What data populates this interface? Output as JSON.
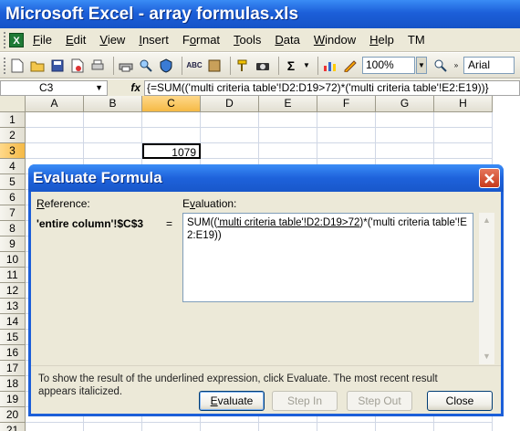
{
  "window": {
    "title": "Microsoft Excel - array formulas.xls"
  },
  "menu": {
    "items": [
      {
        "label": "File",
        "mnemonic": "F",
        "rest": "ile"
      },
      {
        "label": "Edit",
        "mnemonic": "E",
        "rest": "dit"
      },
      {
        "label": "View",
        "mnemonic": "V",
        "rest": "iew"
      },
      {
        "label": "Insert",
        "mnemonic": "I",
        "rest": "nsert"
      },
      {
        "label": "Format",
        "mnemonic": "o",
        "rest": ""
      },
      {
        "label": "Tools",
        "mnemonic": "T",
        "rest": "ools"
      },
      {
        "label": "Data",
        "mnemonic": "D",
        "rest": "ata"
      },
      {
        "label": "Window",
        "mnemonic": "W",
        "rest": "indow"
      },
      {
        "label": "Help",
        "mnemonic": "H",
        "rest": "elp"
      },
      {
        "label": "TM",
        "mnemonic": "",
        "rest": "TM"
      }
    ]
  },
  "toolbar": {
    "zoom": "100%",
    "font": "Arial",
    "sum_glyph": "Σ"
  },
  "formula_bar": {
    "name_box": "C3",
    "fx": "fx",
    "formula": "{=SUM(('multi criteria table'!D2:D19>72)*('multi criteria table'!E2:E19))}"
  },
  "grid": {
    "columns": [
      "A",
      "B",
      "C",
      "D",
      "E",
      "F",
      "G",
      "H"
    ],
    "rows": [
      "1",
      "2",
      "3",
      "4",
      "5",
      "6",
      "7",
      "8",
      "9",
      "10",
      "11",
      "12",
      "13",
      "14",
      "15",
      "16",
      "17",
      "18",
      "19",
      "20",
      "21"
    ],
    "active_column": "C",
    "active_row": "3",
    "c3_value": "1079"
  },
  "dialog": {
    "title": "Evaluate Formula",
    "reference_label": "Reference:",
    "reference_mnemonic": "R",
    "reference_rest": "eference:",
    "reference_value": "'entire column'!$C$3",
    "equals": "=",
    "evaluation_label": "Evaluation:",
    "evaluation_mnemonic": "v",
    "evaluation_pre": "SUM((",
    "evaluation_underlined": "'multi criteria table'!D2:D19>72",
    "evaluation_post": ")*('multi criteria table'!E2:E19))",
    "hint_line1": "To show the result of the underlined expression, click Evaluate.  The most recent result",
    "hint_line2": "appears italicized.",
    "buttons": {
      "evaluate": "Evaluate",
      "step_in": "Step In",
      "step_out": "Step Out",
      "close": "Close"
    }
  }
}
